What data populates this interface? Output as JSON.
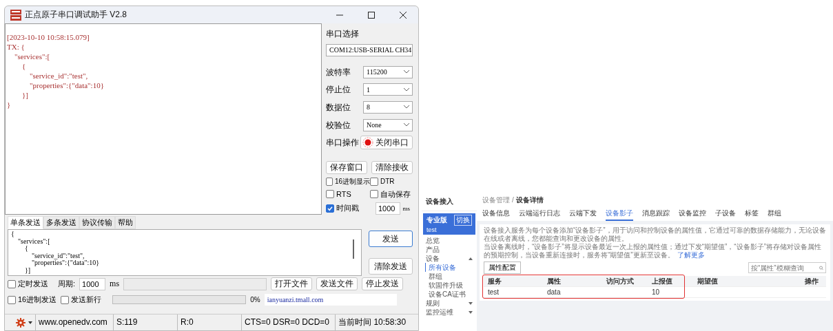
{
  "window": {
    "title": "正点原子串口调试助手 V2.8"
  },
  "receive": {
    "lines": [
      "[2023-10-10 10:58:15.079]",
      "TX: {",
      "    \"services\":[",
      "        {",
      "            \"service_id\":\"test\",",
      "            \"properties\":{\"data\":10}",
      "        }]",
      "}"
    ]
  },
  "serial": {
    "port_label": "串口选择",
    "port": "COM12:USB-SERIAL CH34",
    "fields": [
      {
        "label": "波特率",
        "value": "115200"
      },
      {
        "label": "停止位",
        "value": "1"
      },
      {
        "label": "数据位",
        "value": "8"
      },
      {
        "label": "校验位",
        "value": "None"
      }
    ],
    "operation": {
      "label": "串口操作",
      "button": "关闭串口",
      "open": true
    },
    "buttons": [
      "保存窗口",
      "清除接收"
    ],
    "options": [
      {
        "label": "16进制显示",
        "checked": false
      },
      {
        "label": "DTR",
        "checked": false
      },
      {
        "label": "RTS",
        "checked": false
      },
      {
        "label": "自动保存",
        "checked": false
      },
      {
        "label": "时间戳",
        "checked": true
      }
    ],
    "interval": "1000",
    "interval_unit": "ms"
  },
  "send_tabs": [
    {
      "label": "单条发送",
      "selected": true
    },
    {
      "label": "多条发送",
      "selected": false
    },
    {
      "label": "协议传输",
      "selected": false
    },
    {
      "label": "帮助",
      "selected": false
    }
  ],
  "send": {
    "lines": [
      "{",
      "    \"services\":[",
      "        {",
      "            \"service_id\":\"test\",",
      "            \"properties\":{\"data\":10}",
      "        }]"
    ],
    "buttons": [
      "发送",
      "清除发送"
    ],
    "timed": {
      "label": "定时发送",
      "checked": false
    },
    "period_label": "周期:",
    "period": "1000",
    "period_unit": "ms",
    "file_buttons": [
      "打开文件",
      "发送文件",
      "停止发送"
    ],
    "hex": {
      "label": "16进制发送",
      "checked": false
    },
    "newline": {
      "label": "发送新行",
      "checked": false
    },
    "progress": {
      "level": 0
    },
    "percent": "0%",
    "link": "ianyuanzi.tmall.com"
  },
  "status_bar": [
    "www.openedv.com",
    "S:119",
    "R:0",
    "CTS=0 DSR=0 DCD=0",
    "当前时间 10:58:30"
  ],
  "console": {
    "title": "设备接入",
    "edition": {
      "name": "专业版",
      "switch": "切换",
      "instance": "test"
    },
    "nav": [
      {
        "label": "总览",
        "selected": false
      },
      {
        "label": "产品",
        "selected": false
      },
      {
        "label": "设备",
        "selected": false,
        "expanded": true,
        "children": [
          {
            "label": "所有设备",
            "selected": true
          },
          {
            "label": "群组",
            "selected": false
          },
          {
            "label": "软固件升级",
            "selected": false
          },
          {
            "label": "设备CA证书",
            "selected": false
          }
        ]
      },
      {
        "label": "规则",
        "selected": false,
        "expanded": false
      },
      {
        "label": "监控运维",
        "selected": false,
        "expanded": false
      }
    ],
    "breadcrumb": [
      "设备管理",
      "设备详情"
    ],
    "breadcrumb_separator": "/",
    "tabs": [
      {
        "label": "设备信息",
        "selected": false
      },
      {
        "label": "云端运行日志",
        "selected": false
      },
      {
        "label": "云端下发",
        "selected": false
      },
      {
        "label": "设备影子",
        "selected": true
      },
      {
        "label": "消息跟踪",
        "selected": false
      },
      {
        "label": "设备监控",
        "selected": false
      },
      {
        "label": "子设备",
        "selected": false
      },
      {
        "label": "标签",
        "selected": false
      },
      {
        "label": "群组",
        "selected": false
      }
    ],
    "description": [
      "设备接入服务为每个设备添加“设备影子”，用于访问和控制设备的属性值，它通过可靠的数据存储能力，无论设备在线或者离线，您都能查询和更改设备的属性。",
      "当设备离线时，“设备影子”将显示设备最近一次上报的属性值；通过下发“期望值”，“设备影子”将存储对设备属性的预期控制，当设备重新连接时，服务将“期望值”更新至设备。"
    ],
    "learn_more": "了解更多",
    "config_button": "属性配置",
    "search": {
      "placeholder": "按“属性”模糊查询"
    },
    "table": {
      "columns": [
        "服务",
        "属性",
        "访问方式",
        "上报值",
        "期望值",
        "操作"
      ],
      "rows": [
        [
          "test",
          "data",
          "",
          "10",
          "",
          ""
        ]
      ]
    }
  }
}
